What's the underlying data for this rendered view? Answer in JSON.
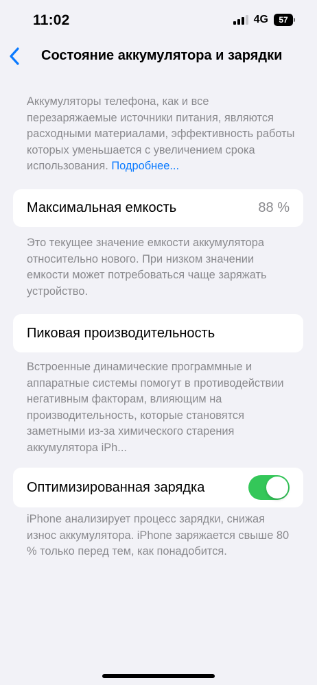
{
  "status_bar": {
    "time": "11:02",
    "network": "4G",
    "battery_level": "57",
    "icons": [
      "signal-icon",
      "battery-icon"
    ]
  },
  "nav": {
    "back_icon": "chevron-left-icon",
    "title": "Состояние аккумулятора и зарядки"
  },
  "intro": {
    "text": "Аккумуляторы телефона, как и все перезаряжаемые источники питания, являются расходными материалами, эффективность работы которых уменьшается с увеличением срока использования.",
    "link": "Подробнее..."
  },
  "max_capacity": {
    "label": "Максимальная емкость",
    "value": "88 %",
    "description": "Это текущее значение емкости аккумулятора относительно нового. При низком значении емкости может потребоваться чаще заряжать устройство."
  },
  "peak_performance": {
    "label": "Пиковая производительность",
    "description": "Встроенные динамические программные и аппаратные системы помогут в противодействии негативным факторам, влияющим на производительность, которые становятся заметными из-за химического старения аккумулятора iPh..."
  },
  "optimized_charging": {
    "label": "Оптимизированная зарядка",
    "enabled": true,
    "description": "iPhone анализирует процесс зарядки, снижая износ аккумулятора. iPhone заряжается свыше 80 % только перед тем, как понадобится."
  },
  "colors": {
    "background": "#f2f2f7",
    "accent": "#0a7aff",
    "toggle_on": "#34c759",
    "secondary_text": "#8a8a8e"
  }
}
